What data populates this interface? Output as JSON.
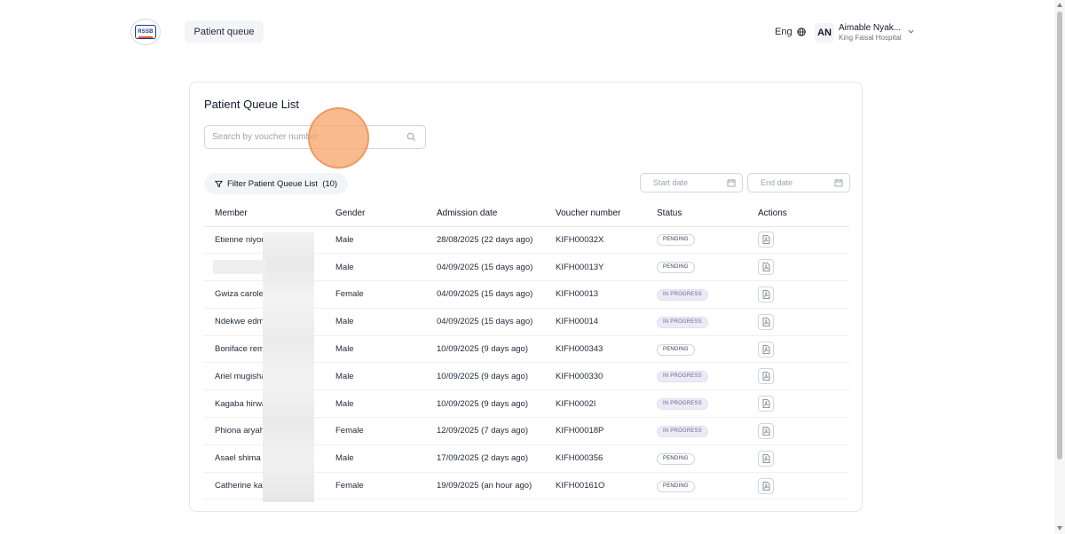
{
  "header": {
    "logo_text": "RSSB",
    "nav_label": "Patient queue",
    "language": "Eng",
    "user_initials": "AN",
    "user_name": "Aimable Nyak...",
    "user_hospital": "King Faisal Hospital"
  },
  "page": {
    "title": "Patient Queue List",
    "search_placeholder": "Search by voucher number",
    "filter_label": "Filter Patient Queue List  (10)",
    "start_date_placeholder": "Start date",
    "end_date_placeholder": "End date"
  },
  "table": {
    "headers": {
      "member": "Member",
      "gender": "Gender",
      "admission": "Admission date",
      "voucher": "Voucher number",
      "status": "Status",
      "actions": "Actions"
    },
    "rows": [
      {
        "member": "Etienne niyon",
        "gender": "Male",
        "admission": "28/08/2025 (22 days ago)",
        "voucher": "KIFH00032X",
        "status": "PENDING",
        "status_type": "pending"
      },
      {
        "member": "",
        "gender": "Male",
        "admission": "04/09/2025 (15 days ago)",
        "voucher": "KIFH00013Y",
        "status": "PENDING",
        "status_type": "pending"
      },
      {
        "member": "Gwiza carole",
        "gender": "Female",
        "admission": "04/09/2025 (15 days ago)",
        "voucher": "KIFH00013",
        "status": "IN PROGRESS",
        "status_type": "progress"
      },
      {
        "member": "Ndekwe edm",
        "gender": "Male",
        "admission": "04/09/2025 (15 days ago)",
        "voucher": "KIFH00014",
        "status": "IN PROGRESS",
        "status_type": "progress"
      },
      {
        "member": "Boniface rem",
        "gender": "Male",
        "admission": "10/09/2025 (9 days ago)",
        "voucher": "KIFH000343",
        "status": "PENDING",
        "status_type": "pending"
      },
      {
        "member": "Ariel mugisha",
        "gender": "Male",
        "admission": "10/09/2025 (9 days ago)",
        "voucher": "KIFH000330",
        "status": "IN PROGRESS",
        "status_type": "progress"
      },
      {
        "member": "Kagaba hirwa",
        "gender": "Male",
        "admission": "10/09/2025 (9 days ago)",
        "voucher": "KIFH0002I",
        "status": "IN PROGRESS",
        "status_type": "progress"
      },
      {
        "member": "Phiona aryah",
        "gender": "Female",
        "admission": "12/09/2025 (7 days ago)",
        "voucher": "KIFH00018P",
        "status": "IN PROGRESS",
        "status_type": "progress"
      },
      {
        "member": "Asael shima k",
        "gender": "Male",
        "admission": "17/09/2025 (2 days ago)",
        "voucher": "KIFH000356",
        "status": "PENDING",
        "status_type": "pending"
      },
      {
        "member": "Catherine kar",
        "gender": "Female",
        "admission": "19/09/2025 (an hour ago)",
        "voucher": "KIFH00161O",
        "status": "PENDING",
        "status_type": "pending"
      }
    ]
  },
  "colors": {
    "accent_click": "#f7a86e",
    "progress_badge_bg": "#eceaf6",
    "pending_badge_border": "#d1d5db"
  },
  "icons": [
    "globe-icon",
    "chevron-down-icon",
    "search-icon",
    "filter-icon",
    "calendar-icon",
    "pdf-document-icon"
  ]
}
